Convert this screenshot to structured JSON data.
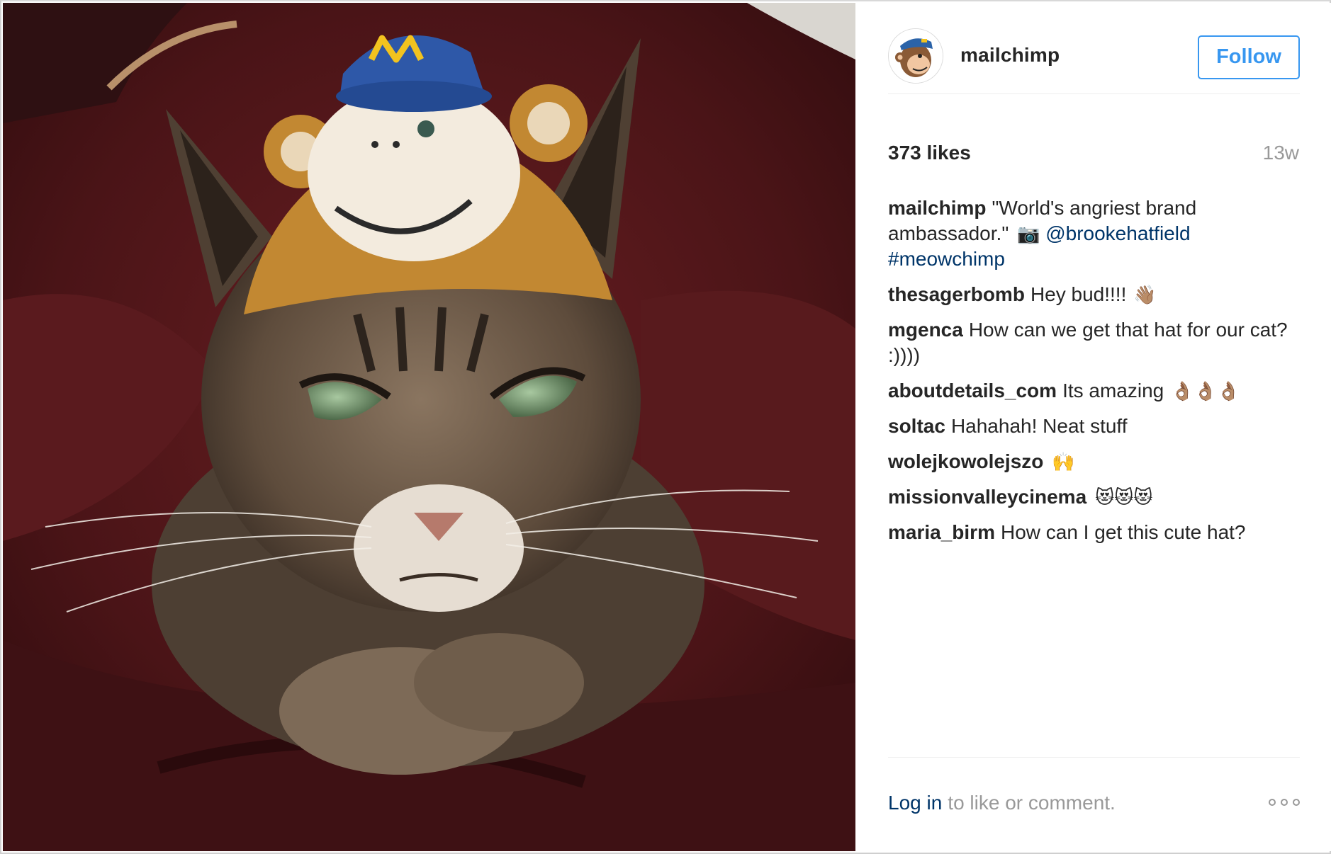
{
  "photo": {
    "subject_icon": "cat-in-monkey-hat-photo"
  },
  "header": {
    "username": "mailchimp",
    "follow_label": "Follow",
    "avatar_icon": "mailchimp-logo-icon"
  },
  "stats": {
    "likes": "373 likes",
    "age": "13w"
  },
  "caption": {
    "user": "mailchimp",
    "text": "\"World's angriest brand ambassador.\"",
    "camera": "📷",
    "mention": "@brookehatfield",
    "hashtag": "#meowchimp"
  },
  "comments": [
    {
      "user": "thesagerbomb",
      "text": "Hey bud!!!!",
      "emoji": "👋🏽"
    },
    {
      "user": "mgenca",
      "text": "How can we get that hat for our cat? :))))",
      "emoji": ""
    },
    {
      "user": "aboutdetails_com",
      "text": "Its amazing",
      "emoji": "👌🏽👌🏽👌🏽"
    },
    {
      "user": "soltac",
      "text": "Hahahah! Neat stuff",
      "emoji": ""
    },
    {
      "user": "wolejkowolejszo",
      "text": "",
      "emoji": "🙌"
    },
    {
      "user": "missionvalleycinema",
      "text": "",
      "emoji": "😻😻😻"
    },
    {
      "user": "maria_birm",
      "text": "How can I get this cute hat?",
      "emoji": ""
    }
  ],
  "footer": {
    "login": "Log in",
    "prompt": "to like or comment.",
    "more_icon": "more-options-icon"
  },
  "colors": {
    "link": "#003569",
    "accent": "#3897f0",
    "muted": "#999999",
    "text": "#262626"
  }
}
